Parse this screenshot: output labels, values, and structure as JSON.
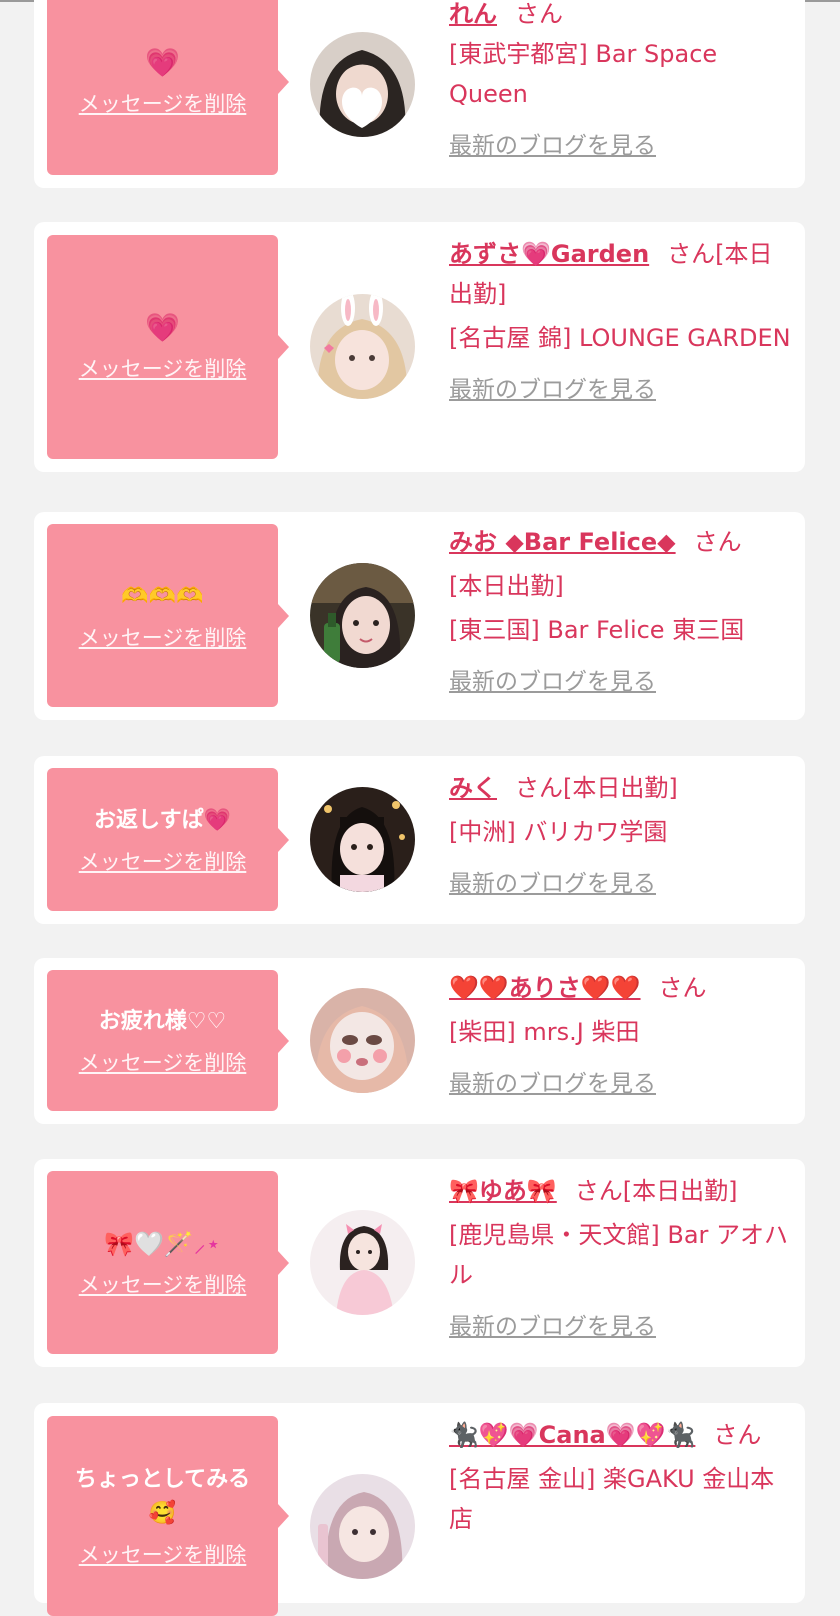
{
  "cards": [
    {
      "message": "💗",
      "delete_label": "メッセージを削除",
      "name": "れん",
      "suffix": "さん",
      "shop": "[東武宇都宮] Bar Space Queen",
      "blog_label": "最新のブログを見る"
    },
    {
      "message": "💗",
      "delete_label": "メッセージを削除",
      "name": "あずさ💗Garden",
      "suffix": "さん[本日出勤]",
      "shop": "[名古屋 錦] LOUNGE GARDEN",
      "blog_label": "最新のブログを見る"
    },
    {
      "message": "🫶🫶🫶",
      "delete_label": "メッセージを削除",
      "name": "みお ◆Bar Felice◆",
      "suffix": "さん",
      "status": "[本日出勤]",
      "shop": "[東三国] Bar Felice 東三国",
      "blog_label": "最新のブログを見る"
    },
    {
      "message": "お返しすぱ💗",
      "delete_label": "メッセージを削除",
      "name": "みく",
      "suffix": "さん[本日出勤]",
      "shop": "[中洲] バリカワ学園",
      "blog_label": "最新のブログを見る"
    },
    {
      "message": "お疲れ様♡♡",
      "delete_label": "メッセージを削除",
      "name": "❤️❤️ありさ❤️❤️",
      "suffix": "さん",
      "shop": "[柴田] mrs.J 柴田",
      "blog_label": "最新のブログを見る"
    },
    {
      "message": "🎀🤍🪄⸝⋆",
      "delete_label": "メッセージを削除",
      "name": "🎀ゆあ🎀",
      "suffix": "さん[本日出勤]",
      "shop": "[鹿児島県・天文館] Bar アオハル",
      "blog_label": "最新のブログを見る"
    },
    {
      "message": "ちょっとしてみる🥰",
      "delete_label": "メッセージを削除",
      "name": "🐈‍⬛💖💗Cana💗💖🐈‍⬛",
      "suffix": "さん",
      "shop": "[名古屋 金山] 楽GAKU 金山本店",
      "blog_label": ""
    }
  ],
  "colors": {
    "page_bg": "#f2f2f2",
    "card_bg": "#ffffff",
    "bubble_bg": "#f8929f",
    "name_color": "#d9365c",
    "blog_link_color": "#9b9b9b"
  }
}
